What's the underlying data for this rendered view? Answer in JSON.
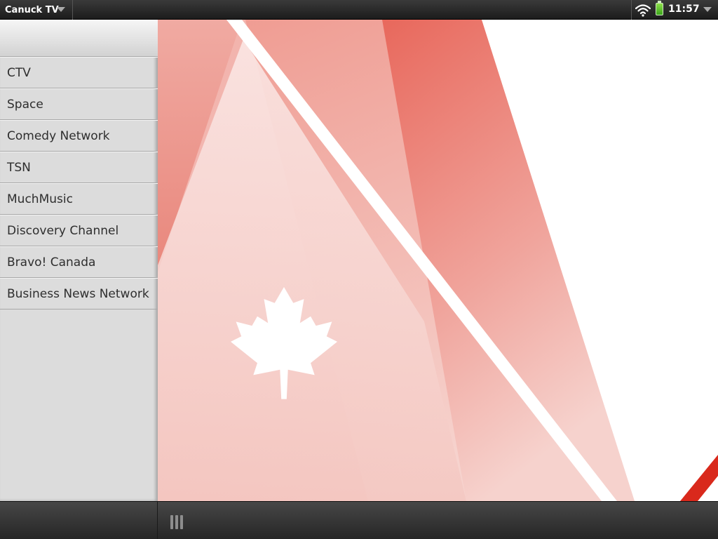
{
  "status_bar": {
    "app_title": "Canuck TV",
    "time": "11:57",
    "icons": [
      "wifi-icon",
      "battery-icon",
      "chevron-down-icon"
    ]
  },
  "sidebar": {
    "items": [
      {
        "label": "CTV"
      },
      {
        "label": "Space"
      },
      {
        "label": "Comedy Network"
      },
      {
        "label": "TSN"
      },
      {
        "label": "MuchMusic"
      },
      {
        "label": "Discovery Channel"
      },
      {
        "label": "Bravo! Canada"
      },
      {
        "label": "Business News Network"
      }
    ]
  },
  "content": {
    "artwork": "maple-leaf-icon",
    "colors": {
      "red_dark": "#e8685c",
      "red_mid": "#f0a49c",
      "red_light": "#f8dcd8",
      "stripe": "#d9291c"
    }
  },
  "bottom_bar": {
    "icons": [
      "drag-handle-icon"
    ]
  }
}
